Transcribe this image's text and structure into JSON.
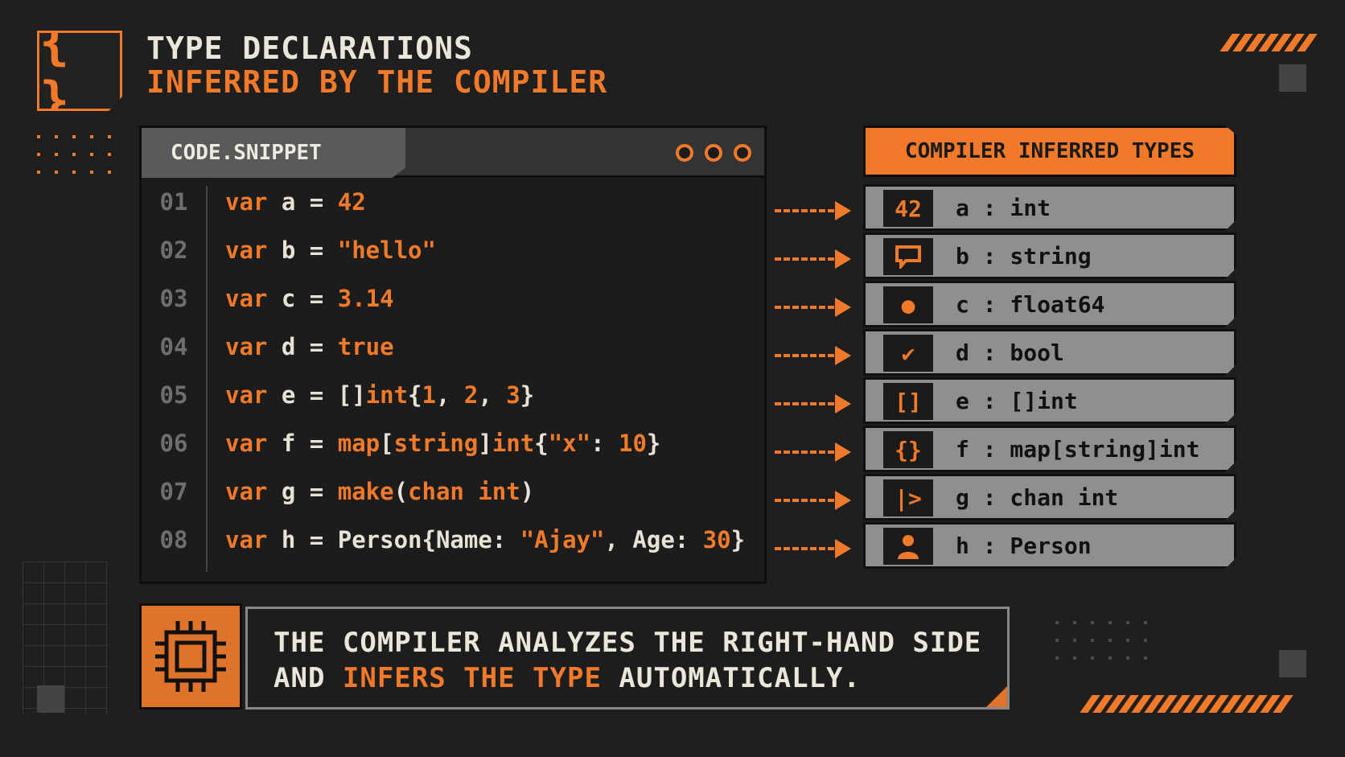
{
  "header": {
    "logo_glyph": "{ }",
    "title_line1": "TYPE DECLARATIONS",
    "title_line2": "INFERRED BY THE COMPILER"
  },
  "code_window": {
    "tab_label": "CODE.SNIPPET",
    "lines": [
      {
        "num": "01",
        "kw": "var",
        "name": "a",
        "eq": "=",
        "parts": [
          {
            "t": "42",
            "c": "lit"
          }
        ]
      },
      {
        "num": "02",
        "kw": "var",
        "name": "b",
        "eq": "=",
        "parts": [
          {
            "t": "\"hello\"",
            "c": "lit"
          }
        ]
      },
      {
        "num": "03",
        "kw": "var",
        "name": "c",
        "eq": "=",
        "parts": [
          {
            "t": "3.14",
            "c": "lit"
          }
        ]
      },
      {
        "num": "04",
        "kw": "var",
        "name": "d",
        "eq": "=",
        "parts": [
          {
            "t": "true",
            "c": "lit"
          }
        ]
      },
      {
        "num": "05",
        "kw": "var",
        "name": "e",
        "eq": "=",
        "parts": [
          {
            "t": "[]",
            "c": "plain"
          },
          {
            "t": "int",
            "c": "lit"
          },
          {
            "t": "{",
            "c": "plain"
          },
          {
            "t": "1",
            "c": "lit"
          },
          {
            "t": ", ",
            "c": "plain"
          },
          {
            "t": "2",
            "c": "lit"
          },
          {
            "t": ", ",
            "c": "plain"
          },
          {
            "t": "3",
            "c": "lit"
          },
          {
            "t": "}",
            "c": "plain"
          }
        ]
      },
      {
        "num": "06",
        "kw": "var",
        "name": "f",
        "eq": "=",
        "parts": [
          {
            "t": "map",
            "c": "lit"
          },
          {
            "t": "[",
            "c": "plain"
          },
          {
            "t": "string",
            "c": "lit"
          },
          {
            "t": "]",
            "c": "plain"
          },
          {
            "t": "int",
            "c": "lit"
          },
          {
            "t": "{",
            "c": "plain"
          },
          {
            "t": "\"x\"",
            "c": "lit"
          },
          {
            "t": ": ",
            "c": "plain"
          },
          {
            "t": "10",
            "c": "lit"
          },
          {
            "t": "}",
            "c": "plain"
          }
        ]
      },
      {
        "num": "07",
        "kw": "var",
        "name": "g",
        "eq": "=",
        "parts": [
          {
            "t": "make",
            "c": "lit"
          },
          {
            "t": "(",
            "c": "plain"
          },
          {
            "t": "chan int",
            "c": "lit"
          },
          {
            "t": ")",
            "c": "plain"
          }
        ]
      },
      {
        "num": "08",
        "kw": "var",
        "name": "h",
        "eq": "=",
        "parts": [
          {
            "t": "Person{Name: ",
            "c": "plain"
          },
          {
            "t": "\"Ajay\"",
            "c": "lit"
          },
          {
            "t": ", Age: ",
            "c": "plain"
          },
          {
            "t": "30",
            "c": "lit"
          },
          {
            "t": "}",
            "c": "plain"
          }
        ]
      }
    ]
  },
  "types_panel": {
    "heading": "COMPILER INFERRED TYPES",
    "rows": [
      {
        "icon": "number-icon",
        "glyph": "42",
        "label": "a : int"
      },
      {
        "icon": "speech-bubble-icon",
        "glyph": "",
        "label": "b : string"
      },
      {
        "icon": "dot-icon",
        "glyph": "●",
        "label": "c : float64"
      },
      {
        "icon": "check-icon",
        "glyph": "✔",
        "label": "d : bool"
      },
      {
        "icon": "brackets-icon",
        "glyph": "[]",
        "label": "e : []int"
      },
      {
        "icon": "braces-icon",
        "glyph": "{}",
        "label": "f : map[string]int"
      },
      {
        "icon": "channel-icon",
        "glyph": "|>",
        "label": "g : chan int"
      },
      {
        "icon": "person-icon",
        "glyph": "",
        "label": "h : Person"
      }
    ]
  },
  "banner": {
    "line1": "THE COMPILER ANALYZES THE RIGHT-HAND SIDE",
    "line2_before": "AND ",
    "line2_accent": "INFERS THE TYPE",
    "line2_after": " AUTOMATICALLY."
  },
  "colors": {
    "accent": "#f07a2a",
    "background": "#1f1f1f",
    "row_bg": "#8f8f8f"
  }
}
